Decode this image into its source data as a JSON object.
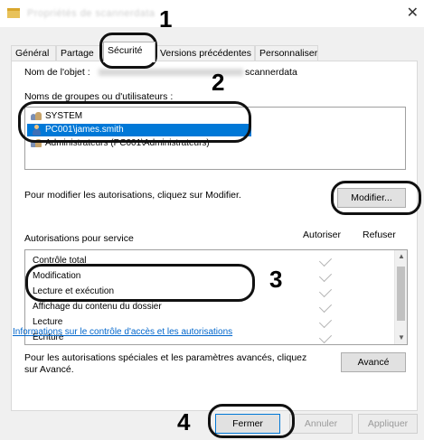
{
  "window": {
    "title": "Propriétés de scannerdata",
    "close_glyph": "✕"
  },
  "tabs": [
    {
      "label": "Général"
    },
    {
      "label": "Partage"
    },
    {
      "label": "Sécurité"
    },
    {
      "label": "Versions précédentes"
    },
    {
      "label": "Personnaliser"
    }
  ],
  "object": {
    "label": "Nom de l'objet :",
    "value_visible": "scannerdata"
  },
  "groups": {
    "label": "Noms de groupes ou d'utilisateurs :",
    "items": [
      {
        "label": "SYSTEM"
      },
      {
        "label": "PC001\\james.smith"
      },
      {
        "label": "Administrateurs (PC001\\Administrateurs)"
      }
    ]
  },
  "modify": {
    "hint": "Pour modifier les autorisations, cliquez sur Modifier.",
    "button": "Modifier..."
  },
  "permissions": {
    "header": "Autorisations pour service",
    "col_allow": "Autoriser",
    "col_deny": "Refuser",
    "rows": [
      {
        "label": "Contrôle total"
      },
      {
        "label": "Modification"
      },
      {
        "label": "Lecture et exécution"
      },
      {
        "label": "Affichage du contenu du dossier"
      },
      {
        "label": "Lecture"
      },
      {
        "label": "Écriture"
      }
    ]
  },
  "advanced": {
    "hint": "Pour les autorisations spéciales et les paramètres avancés, cliquez sur Avancé.",
    "button": "Avancé"
  },
  "link": "Informations sur le contrôle d'accès et les autorisations",
  "footer": {
    "close": "Fermer",
    "cancel": "Annuler",
    "apply": "Appliquer"
  },
  "callouts": [
    "1",
    "2",
    "3",
    "4"
  ]
}
